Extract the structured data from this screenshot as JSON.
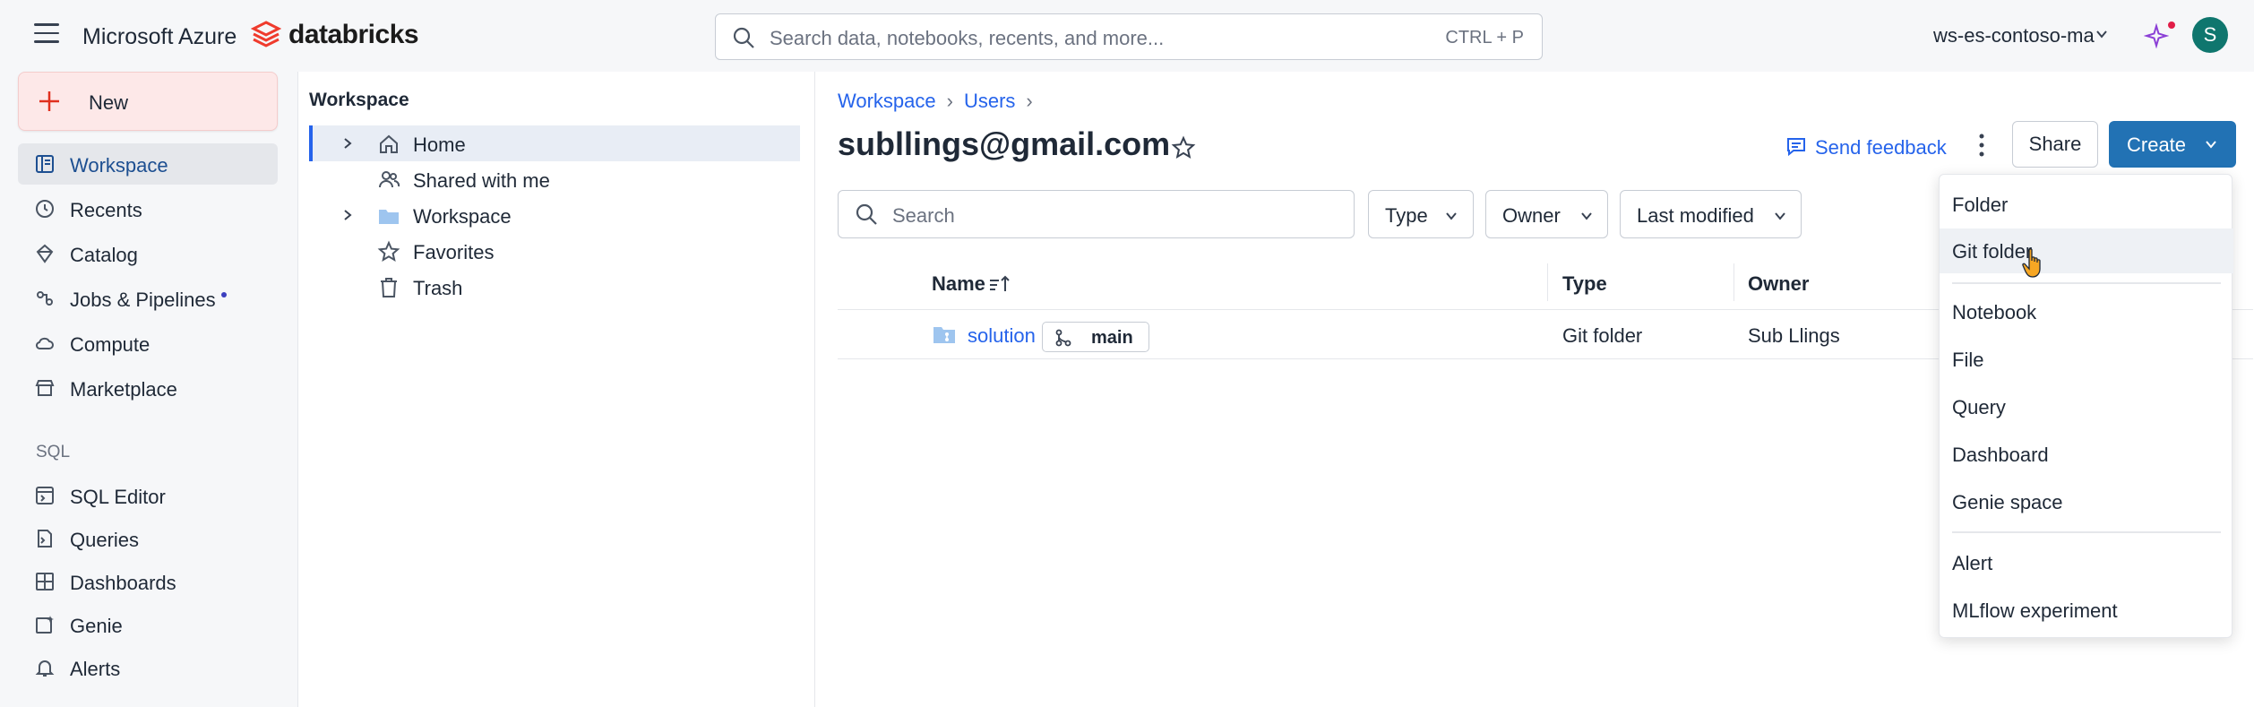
{
  "topbar": {
    "cloud_label": "Microsoft Azure",
    "brand": "databricks",
    "search_placeholder": "Search data, notebooks, recents, and more...",
    "search_shortcut": "CTRL + P",
    "workspace_name": "ws-es-contoso-ma",
    "avatar_initial": "S"
  },
  "sidebar": {
    "new_label": "New",
    "items": [
      {
        "label": "Workspace",
        "icon": "workspace-icon"
      },
      {
        "label": "Recents",
        "icon": "clock-icon"
      },
      {
        "label": "Catalog",
        "icon": "catalog-icon"
      },
      {
        "label": "Jobs & Pipelines",
        "icon": "jobs-icon"
      },
      {
        "label": "Compute",
        "icon": "cloud-icon"
      },
      {
        "label": "Marketplace",
        "icon": "store-icon"
      }
    ],
    "sql_section": "SQL",
    "sql_items": [
      {
        "label": "SQL Editor",
        "icon": "sql-editor-icon"
      },
      {
        "label": "Queries",
        "icon": "queries-icon"
      },
      {
        "label": "Dashboards",
        "icon": "dashboard-icon"
      },
      {
        "label": "Genie",
        "icon": "genie-icon"
      },
      {
        "label": "Alerts",
        "icon": "bell-icon"
      }
    ]
  },
  "tree": {
    "title": "Workspace",
    "items": [
      {
        "label": "Home",
        "icon": "home-icon"
      },
      {
        "label": "Shared with me",
        "icon": "users-icon"
      },
      {
        "label": "Workspace",
        "icon": "folder-icon"
      },
      {
        "label": "Favorites",
        "icon": "star-icon"
      },
      {
        "label": "Trash",
        "icon": "trash-icon"
      }
    ]
  },
  "main": {
    "breadcrumb": [
      "Workspace",
      "Users"
    ],
    "title": "subllings@gmail.com",
    "feedback_label": "Send feedback",
    "share_label": "Share",
    "create_label": "Create",
    "search_placeholder": "Search",
    "filters": [
      "Type",
      "Owner",
      "Last modified"
    ],
    "columns": [
      "Name",
      "Type",
      "Owner"
    ],
    "rows": [
      {
        "name": "solution",
        "branch": "main",
        "type": "Git folder",
        "owner": "Sub Llings"
      }
    ]
  },
  "create_menu": {
    "groups": [
      [
        "Folder",
        "Git folder"
      ],
      [
        "Notebook",
        "File",
        "Query",
        "Dashboard",
        "Genie space"
      ],
      [
        "Alert",
        "MLflow experiment"
      ]
    ]
  },
  "colors": {
    "accent": "#2272b4",
    "link": "#2563eb",
    "new_button_bg": "#fde8e8",
    "avatar_bg": "#0f766e"
  }
}
